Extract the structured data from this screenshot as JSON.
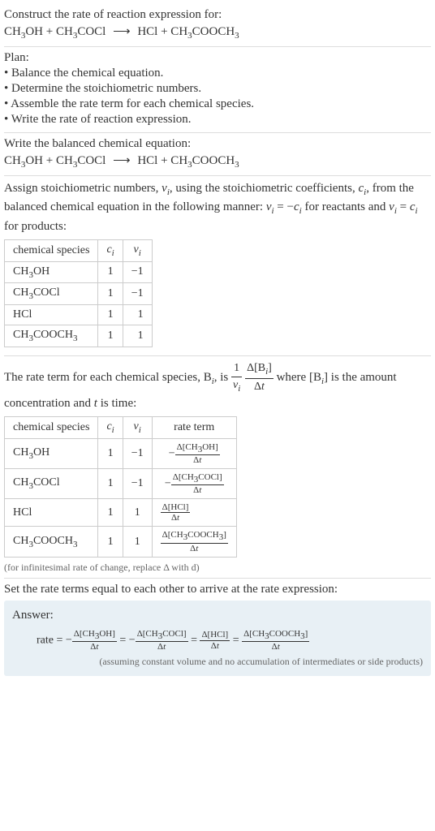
{
  "intro": {
    "construct_label": "Construct the rate of reaction expression for:",
    "equation_lhs1": "CH",
    "equation_lhs1_sub": "3",
    "equation_lhs1b": "OH + CH",
    "equation_lhs1b_sub": "3",
    "equation_lhs1c": "COCl",
    "arrow": "⟶",
    "equation_rhs1": " HCl + CH",
    "equation_rhs1_sub": "3",
    "equation_rhs1b": "COOCH",
    "equation_rhs1b_sub": "3"
  },
  "plan": {
    "heading": "Plan:",
    "items": [
      "• Balance the chemical equation.",
      "• Determine the stoichiometric numbers.",
      "• Assemble the rate term for each chemical species.",
      "• Write the rate of reaction expression."
    ]
  },
  "balanced": {
    "heading": "Write the balanced chemical equation:"
  },
  "stoich": {
    "text1": "Assign stoichiometric numbers, ",
    "nu_i": "ν",
    "sub_i": "i",
    "text2": ", using the stoichiometric coefficients, ",
    "c_i": "c",
    "text3": ", from the balanced chemical equation in the following manner: ",
    "eq1": " = −",
    "text4": " for reactants and ",
    "eq2": " = ",
    "text5": " for products:",
    "headers": [
      "chemical species",
      "c",
      "ν"
    ],
    "header_sub": "i",
    "rows": [
      {
        "species_a": "CH",
        "sub_a": "3",
        "species_b": "OH",
        "c": "1",
        "nu": "−1"
      },
      {
        "species_a": "CH",
        "sub_a": "3",
        "species_b": "COCl",
        "c": "1",
        "nu": "−1"
      },
      {
        "species_a": "HCl",
        "sub_a": "",
        "species_b": "",
        "c": "1",
        "nu": "1"
      },
      {
        "species_a": "CH",
        "sub_a": "3",
        "species_b": "COOCH",
        "sub_b": "3",
        "c": "1",
        "nu": "1"
      }
    ]
  },
  "rate_term": {
    "text1": "The rate term for each chemical species, B",
    "sub_i": "i",
    "text2": ", is ",
    "frac1_num": "1",
    "frac1_den_a": "ν",
    "frac2_num_a": "Δ[B",
    "frac2_num_b": "]",
    "frac2_den": "Δt",
    "text3": " where [B",
    "text4": "] is the amount concentration and ",
    "t": "t",
    "text5": " is time:",
    "headers": [
      "chemical species",
      "c",
      "ν",
      "rate term"
    ],
    "header_sub": "i",
    "rows": [
      {
        "species_a": "CH",
        "sub_a": "3",
        "species_b": "OH",
        "c": "1",
        "nu": "−1",
        "rt_sign": "−",
        "rt_num_a": "Δ[CH",
        "rt_num_sub": "3",
        "rt_num_b": "OH]",
        "rt_den": "Δt"
      },
      {
        "species_a": "CH",
        "sub_a": "3",
        "species_b": "COCl",
        "c": "1",
        "nu": "−1",
        "rt_sign": "−",
        "rt_num_a": "Δ[CH",
        "rt_num_sub": "3",
        "rt_num_b": "COCl]",
        "rt_den": "Δt"
      },
      {
        "species_a": "HCl",
        "sub_a": "",
        "species_b": "",
        "c": "1",
        "nu": "1",
        "rt_sign": "",
        "rt_num_a": "Δ[HCl]",
        "rt_num_sub": "",
        "rt_num_b": "",
        "rt_den": "Δt"
      },
      {
        "species_a": "CH",
        "sub_a": "3",
        "species_b": "COOCH",
        "sub_b": "3",
        "c": "1",
        "nu": "1",
        "rt_sign": "",
        "rt_num_a": "Δ[CH",
        "rt_num_sub": "3",
        "rt_num_b": "COOCH",
        "rt_num_sub2": "3",
        "rt_num_c": "]",
        "rt_den": "Δt"
      }
    ],
    "note": "(for infinitesimal rate of change, replace Δ with d)"
  },
  "final": {
    "heading": "Set the rate terms equal to each other to arrive at the rate expression:",
    "answer_label": "Answer:",
    "rate_label": "rate = ",
    "eq": " = ",
    "neg": "−",
    "t1_num_a": "Δ[CH",
    "t1_sub": "3",
    "t1_num_b": "OH]",
    "den": "Δt",
    "t2_num_a": "Δ[CH",
    "t2_sub": "3",
    "t2_num_b": "COCl]",
    "t3_num": "Δ[HCl]",
    "t4_num_a": "Δ[CH",
    "t4_sub1": "3",
    "t4_num_b": "COOCH",
    "t4_sub2": "3",
    "t4_num_c": "]",
    "assumption": "(assuming constant volume and no accumulation of intermediates or side products)"
  }
}
